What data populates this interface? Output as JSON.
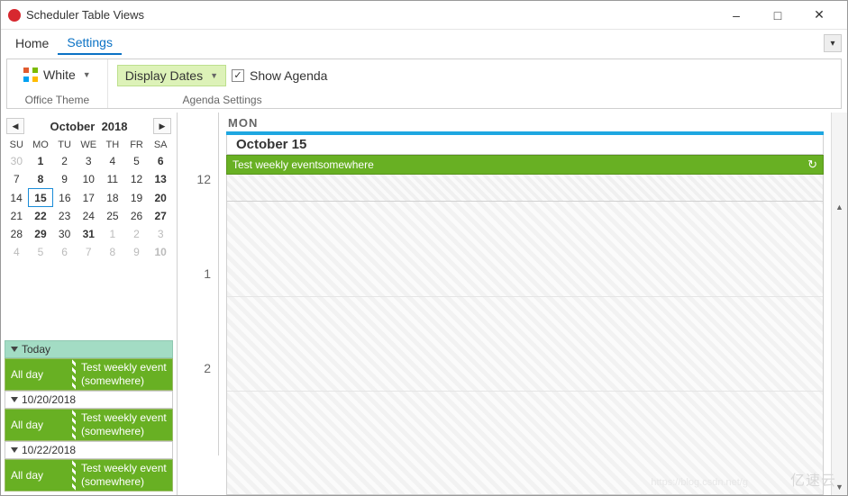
{
  "app": {
    "title": "Scheduler Table Views"
  },
  "menu": {
    "home": "Home",
    "settings": "Settings"
  },
  "ribbon": {
    "theme_btn": "White",
    "theme_group": "Office Theme",
    "dates_btn": "Display Dates",
    "agenda_chk": "Show Agenda",
    "agenda_group": "Agenda Settings"
  },
  "calendar": {
    "month": "October",
    "year": "2018",
    "dow": [
      "SU",
      "MO",
      "TU",
      "WE",
      "TH",
      "FR",
      "SA"
    ],
    "weeks": [
      [
        {
          "n": "30",
          "dim": true
        },
        {
          "n": "1",
          "bold": true
        },
        {
          "n": "2"
        },
        {
          "n": "3"
        },
        {
          "n": "4"
        },
        {
          "n": "5"
        },
        {
          "n": "6",
          "bold": true
        }
      ],
      [
        {
          "n": "7"
        },
        {
          "n": "8",
          "bold": true
        },
        {
          "n": "9"
        },
        {
          "n": "10"
        },
        {
          "n": "11"
        },
        {
          "n": "12"
        },
        {
          "n": "13",
          "bold": true
        }
      ],
      [
        {
          "n": "14"
        },
        {
          "n": "15",
          "bold": true,
          "today": true
        },
        {
          "n": "16"
        },
        {
          "n": "17"
        },
        {
          "n": "18"
        },
        {
          "n": "19"
        },
        {
          "n": "20",
          "bold": true
        }
      ],
      [
        {
          "n": "21"
        },
        {
          "n": "22",
          "bold": true
        },
        {
          "n": "23"
        },
        {
          "n": "24"
        },
        {
          "n": "25"
        },
        {
          "n": "26"
        },
        {
          "n": "27",
          "bold": true
        }
      ],
      [
        {
          "n": "28"
        },
        {
          "n": "29",
          "bold": true
        },
        {
          "n": "30"
        },
        {
          "n": "31",
          "bold": true
        },
        {
          "n": "1",
          "dim": true
        },
        {
          "n": "2",
          "dim": true
        },
        {
          "n": "3",
          "dim": true
        }
      ],
      [
        {
          "n": "4",
          "dim": true
        },
        {
          "n": "5",
          "dim": true
        },
        {
          "n": "6",
          "dim": true
        },
        {
          "n": "7",
          "dim": true
        },
        {
          "n": "8",
          "dim": true
        },
        {
          "n": "9",
          "dim": true
        },
        {
          "n": "10",
          "dim": true,
          "bold": true
        }
      ]
    ]
  },
  "agenda": {
    "groups": [
      {
        "header": "Today",
        "primary": true,
        "items": [
          {
            "time": "All day",
            "title": "Test weekly event",
            "loc": "(somewhere)"
          }
        ]
      },
      {
        "header": "10/20/2018",
        "items": [
          {
            "time": "All day",
            "title": "Test weekly event",
            "loc": "(somewhere)"
          }
        ]
      },
      {
        "header": "10/22/2018",
        "items": [
          {
            "time": "All day",
            "title": "Test weekly event",
            "loc": "(somewhere)"
          }
        ]
      }
    ]
  },
  "dayview": {
    "dow": "MON",
    "title": "October 15",
    "event": "Test weekly eventsomewhere",
    "hours": [
      "12",
      "1",
      "2"
    ]
  },
  "watermark": {
    "brand": "亿速云",
    "url": "https://blog.csdn.net/g"
  }
}
